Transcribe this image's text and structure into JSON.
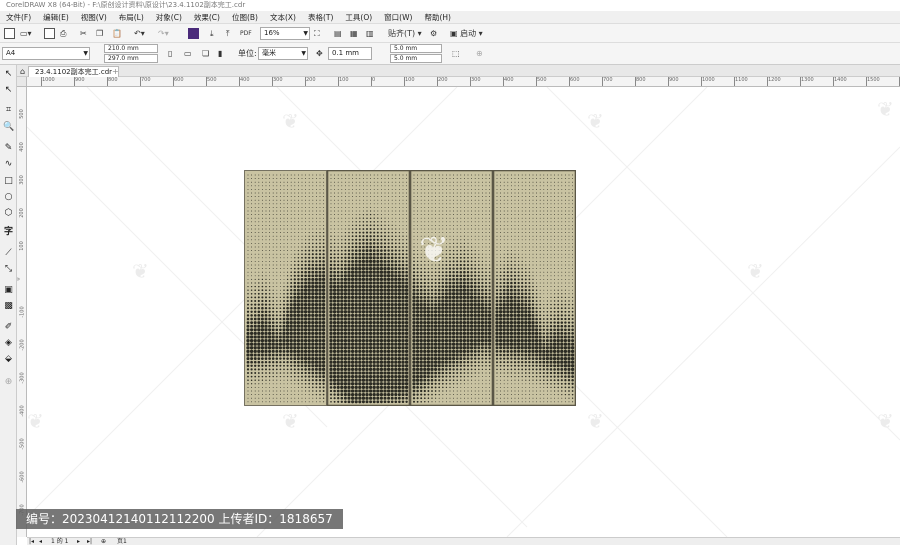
{
  "window": {
    "title": "CorelDRAW X8 (64-Bit) - F:\\原创设计资料\\原设计\\23.4.1102副本完工.cdr"
  },
  "menu": [
    "文件(F)",
    "编辑(E)",
    "视图(V)",
    "布局(L)",
    "对象(C)",
    "效果(C)",
    "位图(B)",
    "文本(X)",
    "表格(T)",
    "工具(O)",
    "窗口(W)",
    "帮助(H)"
  ],
  "toolbar": {
    "zoom": "16%",
    "snap_label": "贴齐(T)",
    "launch_label": "启动",
    "pdf_label": "PDF"
  },
  "property_bar": {
    "page_size": "A4",
    "width": "210.0 mm",
    "height": "297.0 mm",
    "units_label": "单位:",
    "units": "毫米",
    "nudge": "0.1 mm",
    "dup_x": "5.0 mm",
    "dup_y": "5.0 mm"
  },
  "document_tab": "23.4.1102副本完工.cdr",
  "ruler": {
    "h_labels": [
      "1000",
      "900",
      "800",
      "700",
      "600",
      "500",
      "400",
      "300",
      "200",
      "100",
      "0",
      "100",
      "200",
      "300",
      "400",
      "500",
      "600",
      "700",
      "800",
      "900",
      "1000",
      "1100",
      "1200",
      "1300",
      "1400",
      "1500",
      "1600"
    ],
    "v_labels": [
      "500",
      "400",
      "300",
      "200",
      "100",
      "0",
      "-100",
      "-200",
      "-300",
      "-400",
      "-500",
      "-600",
      "-700",
      "-800"
    ]
  },
  "artwork": {
    "panel_color": "#c9c3a2",
    "ink_color": "#2a2a22",
    "panel_count": 4
  },
  "status": {
    "page_counter": "1 的 1",
    "page_name": "页1"
  },
  "watermark": {
    "text": "编号：20230412140112112200  上传者ID：1818657"
  }
}
